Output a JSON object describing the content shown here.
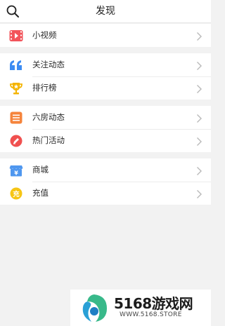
{
  "header": {
    "title": "发现"
  },
  "groups": [
    {
      "items": [
        {
          "label": "小视频",
          "icon": "video-icon"
        }
      ]
    },
    {
      "items": [
        {
          "label": "关注动态",
          "icon": "quote-icon"
        },
        {
          "label": "排行榜",
          "icon": "trophy-icon"
        }
      ]
    },
    {
      "items": [
        {
          "label": "六房动态",
          "icon": "list-icon"
        },
        {
          "label": "热门活动",
          "icon": "activity-icon"
        }
      ]
    },
    {
      "items": [
        {
          "label": "商城",
          "icon": "shop-icon"
        },
        {
          "label": "充值",
          "icon": "recharge-icon"
        }
      ]
    }
  ],
  "watermark": {
    "brand": "5168游戏网",
    "url": "WWW.5168.STORE"
  },
  "colors": {
    "background": "#f2f2f2",
    "video": "#f2545b",
    "quote": "#3d8cf2",
    "trophy": "#f4b400",
    "list": "#f5843c",
    "activity": "#f0504f",
    "shop": "#4f97ef",
    "recharge": "#f6c514"
  }
}
